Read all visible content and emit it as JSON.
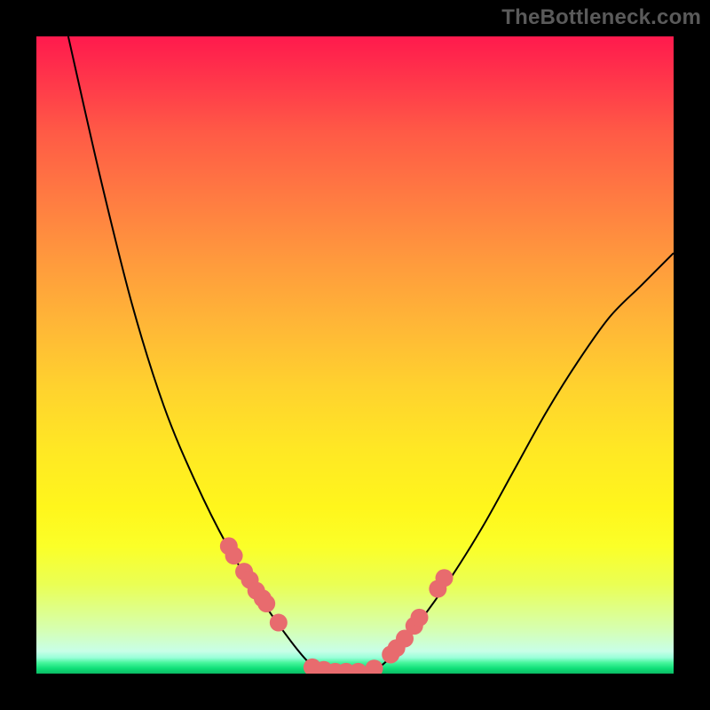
{
  "watermark": "TheBottleneck.com",
  "colors": {
    "background": "#000000",
    "curve": "#000000",
    "dot_fill": "#e86b6e",
    "dot_stroke": "#d45f63"
  },
  "chart_data": {
    "type": "line",
    "title": "",
    "xlabel": "",
    "ylabel": "",
    "xlim": [
      0,
      1
    ],
    "ylim": [
      0,
      1
    ],
    "series": [
      {
        "name": "bottleneck-curve-left",
        "x": [
          0.05,
          0.1,
          0.15,
          0.2,
          0.25,
          0.3,
          0.35,
          0.4,
          0.43,
          0.455
        ],
        "y": [
          1.0,
          0.78,
          0.58,
          0.42,
          0.3,
          0.2,
          0.12,
          0.05,
          0.015,
          0.0
        ]
      },
      {
        "name": "bottleneck-curve-right",
        "x": [
          0.52,
          0.55,
          0.6,
          0.65,
          0.7,
          0.75,
          0.8,
          0.85,
          0.9,
          0.95,
          1.0
        ],
        "y": [
          0.0,
          0.02,
          0.08,
          0.15,
          0.23,
          0.32,
          0.41,
          0.49,
          0.56,
          0.61,
          0.66
        ]
      }
    ],
    "points": {
      "name": "highlighted-data-points",
      "x": [
        0.302,
        0.31,
        0.326,
        0.335,
        0.345,
        0.355,
        0.361,
        0.38,
        0.433,
        0.451,
        0.469,
        0.486,
        0.505,
        0.53,
        0.556,
        0.565,
        0.578,
        0.593,
        0.601,
        0.63,
        0.64
      ],
      "y": [
        0.2,
        0.185,
        0.16,
        0.147,
        0.13,
        0.118,
        0.11,
        0.08,
        0.01,
        0.006,
        0.003,
        0.003,
        0.003,
        0.008,
        0.03,
        0.04,
        0.055,
        0.075,
        0.088,
        0.133,
        0.15
      ]
    }
  }
}
